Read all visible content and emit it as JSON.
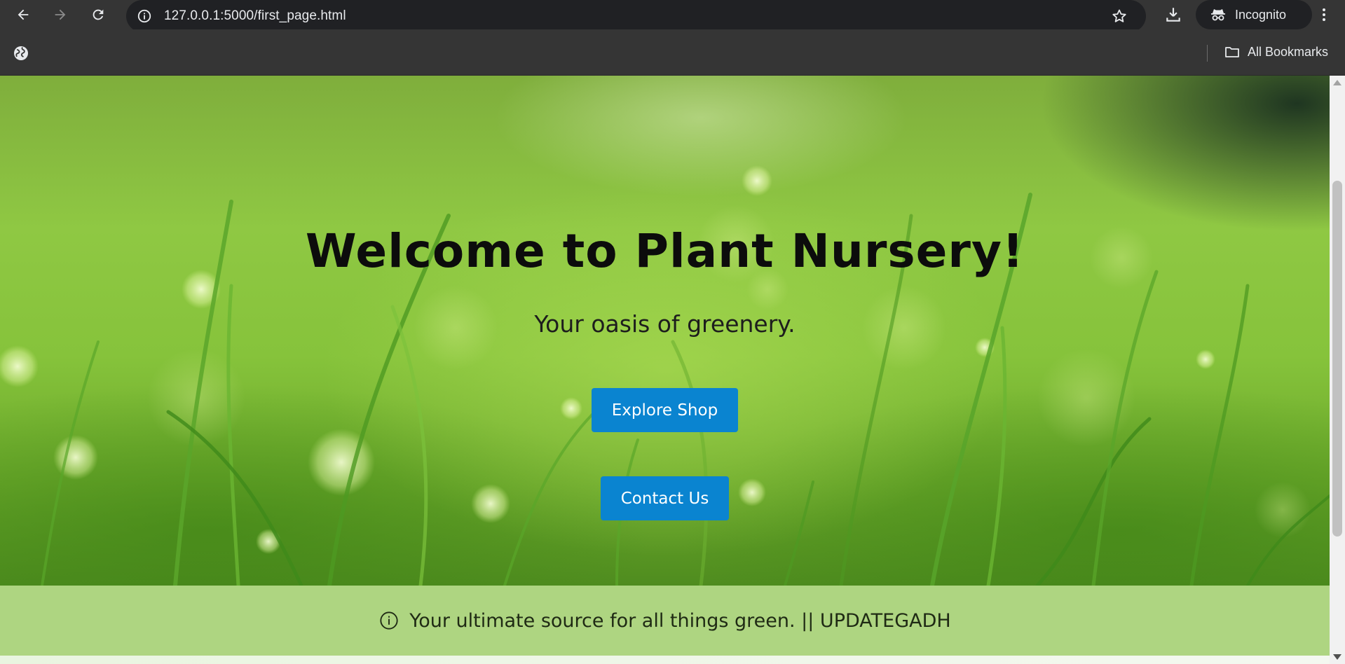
{
  "browser": {
    "url": "127.0.0.1:5000/first_page.html",
    "incognito_label": "Incognito",
    "bookmarks_label": "All Bookmarks",
    "icons": [
      "back-arrow-icon",
      "forward-arrow-icon",
      "reload-icon",
      "site-info-icon",
      "bookmark-star-icon",
      "download-icon",
      "incognito-icon",
      "kebab-menu-icon",
      "globe-icon",
      "folder-icon"
    ]
  },
  "hero": {
    "title": "Welcome to Plant Nursery!",
    "subtitle": "Your oasis of greenery.",
    "explore_label": "Explore Shop",
    "contact_label": "Contact Us"
  },
  "footer": {
    "text": "Your ultimate source for all things green. || UPDATEGADH",
    "icon": "info-circle-icon"
  },
  "colors": {
    "button_blue": "#0a84d0",
    "footer_green": "#aed581",
    "chrome_dark": "#353535",
    "omnibox_dark": "#202124"
  }
}
